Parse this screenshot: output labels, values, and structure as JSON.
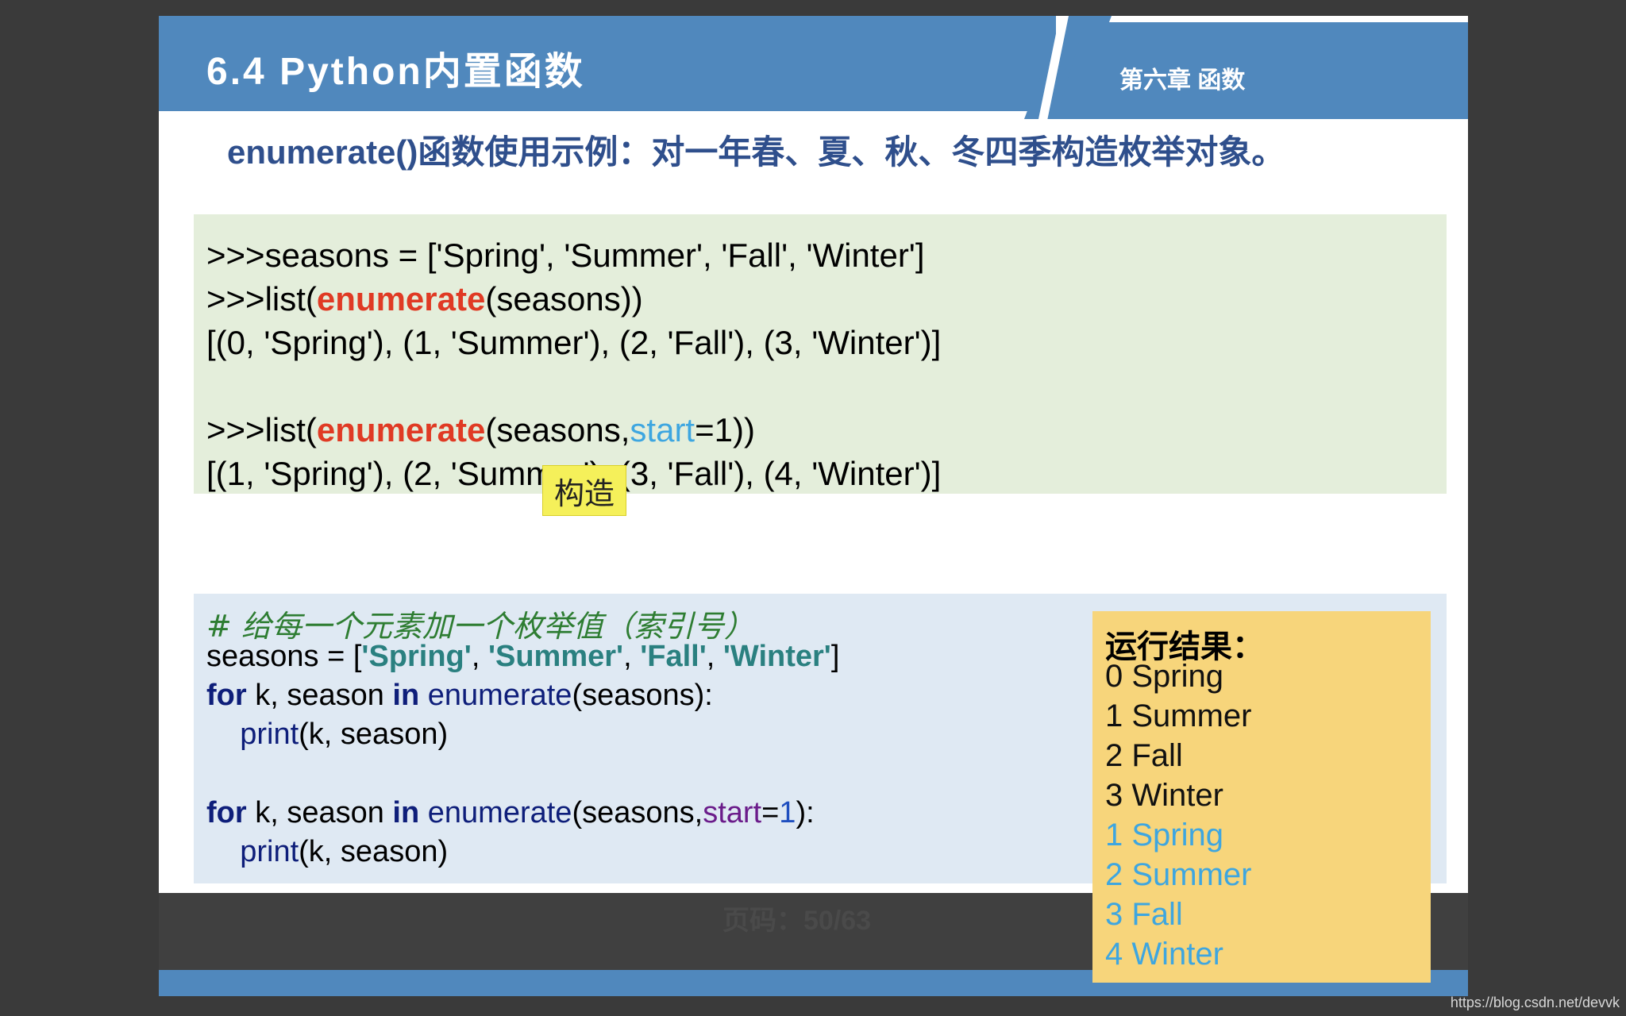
{
  "header": {
    "title": "6.4 Python内置函数",
    "chapter": "第六章  函数"
  },
  "subtitle": "enumerate()函数使用示例：对一年春、夏、秋、冬四季构造枚举对象。",
  "code_block_1": {
    "line1": ">>>seasons = ['Spring', 'Summer', 'Fall', 'Winter']",
    "line2_pre": ">>>list(",
    "line2_fn": "enumerate",
    "line2_post": "(seasons))",
    "line3": "[(0, 'Spring'), (1, 'Summer'), (2, 'Fall'), (3, 'Winter')]",
    "line4_pre": ">>>list(",
    "line4_fn": "enumerate",
    "line4_mid": "(seasons,",
    "line4_param": "start",
    "line4_post": "=1))",
    "line5": "[(1, 'Spring'), (2, 'Summer'), (3, 'Fall'), (4, 'Winter')]"
  },
  "tooltip": "构造",
  "page_indicator": "页码：50/63",
  "code_block_2": {
    "comment": "# 给每一个元素加一个枚举值（索引号）",
    "assign_pre": "seasons = [",
    "s1": "'Spring'",
    "s2": "'Summer'",
    "s3": "'Fall'",
    "s4": "'Winter'",
    "comma": ", ",
    "assign_post": "]",
    "kw_for": "for",
    "loop_vars": " k, season ",
    "kw_in": "in",
    "fn_enumerate": " enumerate",
    "loop1_post": "(seasons):",
    "indent": "    ",
    "fn_print": "print",
    "print_args": "(k, season)",
    "loop2_mid": "(seasons,",
    "loop2_param": "start",
    "loop2_eq": "=",
    "loop2_num": "1",
    "loop2_post": "):"
  },
  "result": {
    "title": "运行结果：",
    "lines_black": [
      "0 Spring",
      "1 Summer",
      "2 Fall",
      "3 Winter"
    ],
    "lines_blue": [
      "1 Spring",
      "2 Summer",
      "3 Fall",
      "4 Winter"
    ]
  },
  "watermark": "https://blog.csdn.net/devvk",
  "colors": {
    "header_blue": "#5088bd",
    "code_green_bg": "#e4eedb",
    "code_blue_bg": "#dfe9f3",
    "result_bg": "#f7d57b",
    "highlight_red": "#e03a24",
    "highlight_blue": "#3ea6e0"
  }
}
